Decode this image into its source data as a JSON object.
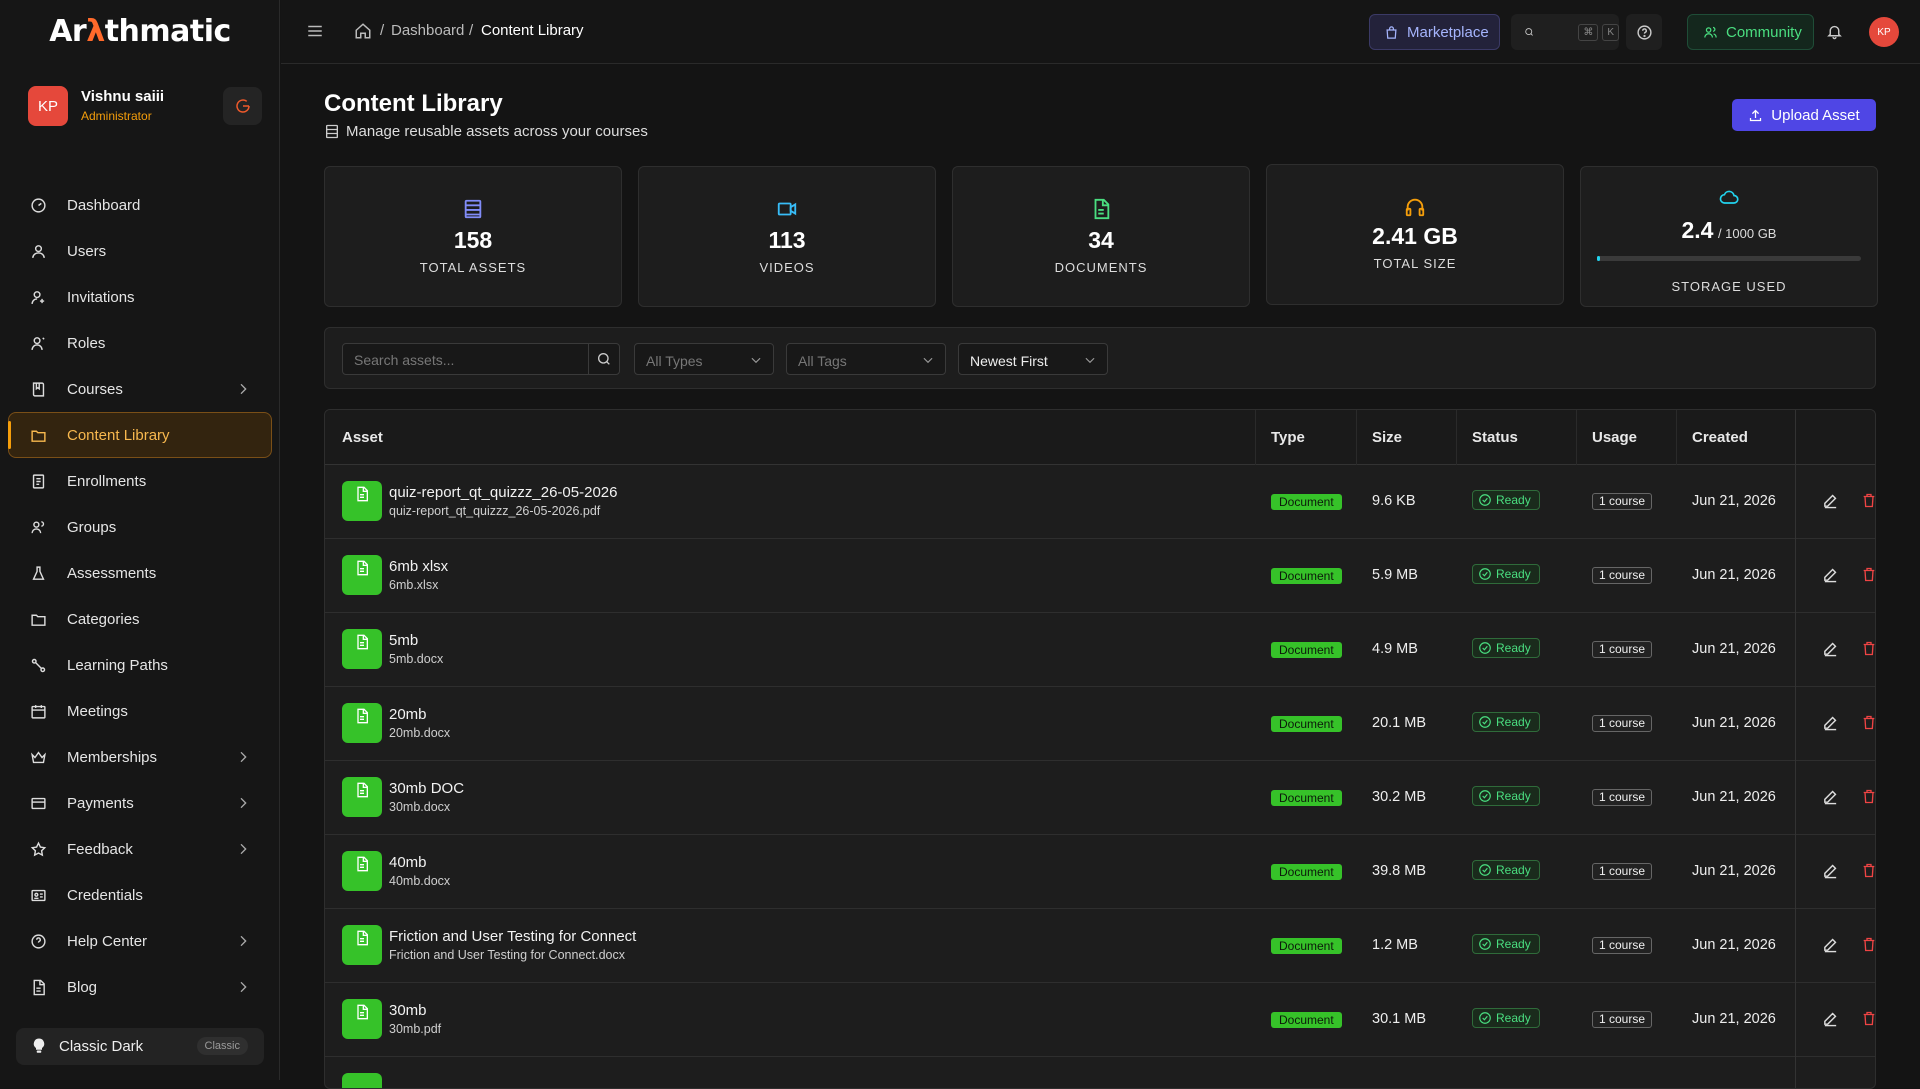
{
  "brand": {
    "logo_pre": "Ar",
    "logo_hl": "λ",
    "logo_post": "thmatic"
  },
  "user": {
    "initials": "KP",
    "name": "Vishnu saiii",
    "role": "Administrator"
  },
  "nav": [
    {
      "label": "Dashboard",
      "icon": "dashboard-icon",
      "chevron": false
    },
    {
      "label": "Users",
      "icon": "user-icon",
      "chevron": false
    },
    {
      "label": "Invitations",
      "icon": "invitation-icon",
      "chevron": false
    },
    {
      "label": "Roles",
      "icon": "roles-icon",
      "chevron": false
    },
    {
      "label": "Courses",
      "icon": "book-icon",
      "chevron": true
    },
    {
      "label": "Content Library",
      "icon": "folder-icon",
      "chevron": false,
      "active": true
    },
    {
      "label": "Enrollments",
      "icon": "enrollments-icon",
      "chevron": false
    },
    {
      "label": "Groups",
      "icon": "groups-icon",
      "chevron": false
    },
    {
      "label": "Assessments",
      "icon": "flask-icon",
      "chevron": false
    },
    {
      "label": "Categories",
      "icon": "folder-icon",
      "chevron": false
    },
    {
      "label": "Learning Paths",
      "icon": "route-icon",
      "chevron": false
    },
    {
      "label": "Meetings",
      "icon": "calendar-icon",
      "chevron": false
    },
    {
      "label": "Memberships",
      "icon": "crown-icon",
      "chevron": true
    },
    {
      "label": "Payments",
      "icon": "credit-card-icon",
      "chevron": true
    },
    {
      "label": "Feedback",
      "icon": "star-icon",
      "chevron": true
    },
    {
      "label": "Credentials",
      "icon": "id-card-icon",
      "chevron": false
    },
    {
      "label": "Help Center",
      "icon": "help-icon",
      "chevron": true
    },
    {
      "label": "Blog",
      "icon": "document-icon",
      "chevron": true
    }
  ],
  "theme": {
    "label": "Classic Dark",
    "badge": "Classic"
  },
  "breadcrumb": {
    "dashboard": "Dashboard",
    "separator": "/",
    "current": "Content Library"
  },
  "topbar": {
    "marketplace": "Marketplace",
    "kbd1": "⌘",
    "kbd2": "K",
    "community": "Community",
    "avatar": "KP"
  },
  "page": {
    "title": "Content Library",
    "subtitle": "Manage reusable assets across your courses",
    "upload": "Upload Asset"
  },
  "stats": {
    "total_assets": {
      "value": "158",
      "label": "TOTAL ASSETS"
    },
    "videos": {
      "value": "113",
      "label": "VIDEOS"
    },
    "documents": {
      "value": "34",
      "label": "DOCUMENTS"
    },
    "total_size": {
      "value": "2.41 GB",
      "label": "TOTAL SIZE"
    },
    "storage": {
      "value": "2.4",
      "of": "/ 1000 GB",
      "label": "STORAGE USED",
      "fraction": 0.0024
    }
  },
  "filters": {
    "search_placeholder": "Search assets...",
    "type": "All Types",
    "tags": "All Tags",
    "sort": "Newest First"
  },
  "table": {
    "headers": {
      "asset": "Asset",
      "type": "Type",
      "size": "Size",
      "status": "Status",
      "usage": "Usage",
      "created": "Created"
    },
    "rows": [
      {
        "name": "quiz-report_qt_quizzz_26-05-2026",
        "file": "quiz-report_qt_quizzz_26-05-2026.pdf",
        "type": "Document",
        "size": "9.6 KB",
        "status": "Ready",
        "usage": "1 course",
        "created": "Jun 21, 2026"
      },
      {
        "name": "6mb xlsx",
        "file": "6mb.xlsx",
        "type": "Document",
        "size": "5.9 MB",
        "status": "Ready",
        "usage": "1 course",
        "created": "Jun 21, 2026"
      },
      {
        "name": "5mb",
        "file": "5mb.docx",
        "type": "Document",
        "size": "4.9 MB",
        "status": "Ready",
        "usage": "1 course",
        "created": "Jun 21, 2026"
      },
      {
        "name": "20mb",
        "file": "20mb.docx",
        "type": "Document",
        "size": "20.1 MB",
        "status": "Ready",
        "usage": "1 course",
        "created": "Jun 21, 2026"
      },
      {
        "name": "30mb DOC",
        "file": "30mb.docx",
        "type": "Document",
        "size": "30.2 MB",
        "status": "Ready",
        "usage": "1 course",
        "created": "Jun 21, 2026"
      },
      {
        "name": "40mb",
        "file": "40mb.docx",
        "type": "Document",
        "size": "39.8 MB",
        "status": "Ready",
        "usage": "1 course",
        "created": "Jun 21, 2026"
      },
      {
        "name": "Friction and User Testing for Connect",
        "file": "Friction and User Testing for Connect.docx",
        "type": "Document",
        "size": "1.2 MB",
        "status": "Ready",
        "usage": "1 course",
        "created": "Jun 21, 2026"
      },
      {
        "name": "30mb",
        "file": "30mb.pdf",
        "type": "Document",
        "size": "30.1 MB",
        "status": "Ready",
        "usage": "1 course",
        "created": "Jun 21, 2026"
      }
    ]
  },
  "colors": {
    "accent": "#f59e0b",
    "primary": "#4f46e5",
    "doc_green": "#36c229",
    "danger": "#ef4444"
  }
}
